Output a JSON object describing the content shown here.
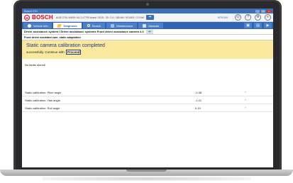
{
  "window": {
    "title": "Bosch ESI",
    "controls": [
      "_",
      "□",
      "x"
    ]
  },
  "header": {
    "brand": "BOSCH",
    "vehicle": "AUDI 27/6 / A4B9 / A4 2.4 TFSI Avant / 2015 - 30 / 2.4 / 165 kW / 4G4002 / 2.9 kW",
    "arrow": "➔",
    "code": "N79.5/0",
    "icons": [
      "camera-icon",
      "help-icon",
      "settings-icon",
      "menu-icon"
    ],
    "icon_glyphs": [
      "◎",
      "?",
      "⚙",
      "≡"
    ]
  },
  "nav": {
    "tabs": [
      {
        "label": "Vehicle info",
        "icon": "info-icon"
      },
      {
        "label": "Diagnosis",
        "icon": "diagnosis-icon",
        "active": true
      },
      {
        "label": "Search",
        "icon": "search-icon"
      },
      {
        "label": "Maintenance",
        "icon": "maintenance-icon"
      },
      {
        "label": "Manuals",
        "icon": "manuals-icon"
      }
    ],
    "right_buttons": [
      "▣",
      "▤",
      "▶"
    ]
  },
  "breadcrumb": "Driver assistance system / Driver assistance systems Front driver assistance camera 4.4",
  "subtitle": "Front driver assistant cam. static adaptation",
  "message": {
    "title": "Static camera calibration completed",
    "line": "successfully. Continue with",
    "proceed_label": "Proceed"
  },
  "faults_text": "No faults stored!",
  "readings": [
    {
      "name": "Static calibration: Pitch angle",
      "value": "-0.38",
      "unit": "°"
    },
    {
      "name": "Static calibration: Yaw angle",
      "value": "-1.01",
      "unit": "°"
    },
    {
      "name": "Static calibration: Roll angle",
      "value": "0.19",
      "unit": "°"
    }
  ],
  "colors": {
    "brand_red": "#e2001a",
    "nav_blue": "#2f64b4",
    "message_bg": "#fbe9a0"
  }
}
